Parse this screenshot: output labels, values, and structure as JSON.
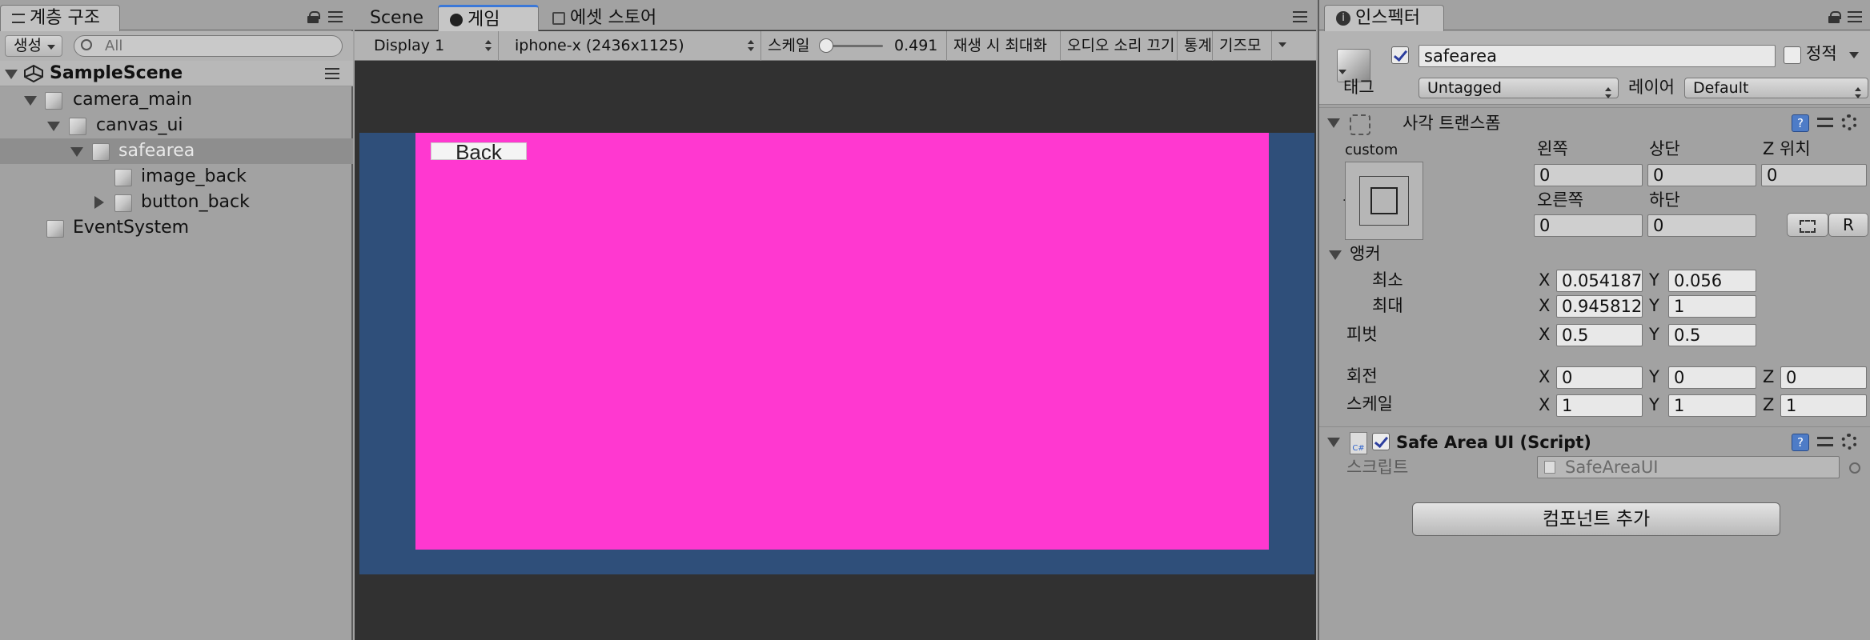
{
  "hierarchy": {
    "tab_label": "계층 구조",
    "create_label": "생성",
    "search_placeholder": "All",
    "scene_name": "SampleScene",
    "items": [
      {
        "label": "camera_main"
      },
      {
        "label": "canvas_ui"
      },
      {
        "label": "safearea"
      },
      {
        "label": "image_back"
      },
      {
        "label": "button_back"
      },
      {
        "label": "EventSystem"
      }
    ]
  },
  "game": {
    "tabs": [
      {
        "label": "Scene"
      },
      {
        "label": "게임"
      },
      {
        "label": "에셋 스토어"
      }
    ],
    "display": "Display 1",
    "resolution": "iphone-x (2436x1125)",
    "scale_label": "스케일",
    "scale_value": "0.491",
    "maximize_label": "재생 시 최대화",
    "mute_label": "오디오 소리 끄기",
    "stats_label": "통계",
    "gizmos_label": "기즈모",
    "back_button_label": "Back",
    "colors": {
      "canvas": "#2f4f7a",
      "safe_area": "#ff38d0",
      "background": "#313131"
    }
  },
  "inspector": {
    "tab_label": "인스펙터",
    "object_name": "safearea",
    "static_label": "정적",
    "tag_label": "태그",
    "tag_value": "Untagged",
    "layer_label": "레이어",
    "layer_value": "Default",
    "rect_transform": {
      "title": "사각 트랜스폼",
      "preset_h": "custom",
      "preset_v": "custom",
      "left_label": "왼쪽",
      "top_label": "상단",
      "posz_label": "Z 위치",
      "left": "0",
      "top": "0",
      "posz": "0",
      "right_label": "오른쪽",
      "bottom_label": "하단",
      "right": "0",
      "bottom": "0",
      "raw_btn": "R",
      "anchor_label": "앵커",
      "min_label": "최소",
      "max_label": "최대",
      "min_x": "0.054187",
      "min_y": "0.056",
      "max_x": "0.945812",
      "max_y": "1",
      "pivot_label": "피벗",
      "pivot_x": "0.5",
      "pivot_y": "0.5",
      "rotation_label": "회전",
      "rot_x": "0",
      "rot_y": "0",
      "rot_z": "0",
      "scale_label": "스케일",
      "scale_x": "1",
      "scale_y": "1",
      "scale_z": "1",
      "x": "X",
      "y": "Y",
      "z": "Z"
    },
    "script_component": {
      "title": "Safe Area UI (Script)",
      "script_label": "스크립트",
      "script_value": "SafeAreaUI",
      "cs_badge": "C#"
    },
    "add_component_label": "컴포넌트 추가"
  }
}
